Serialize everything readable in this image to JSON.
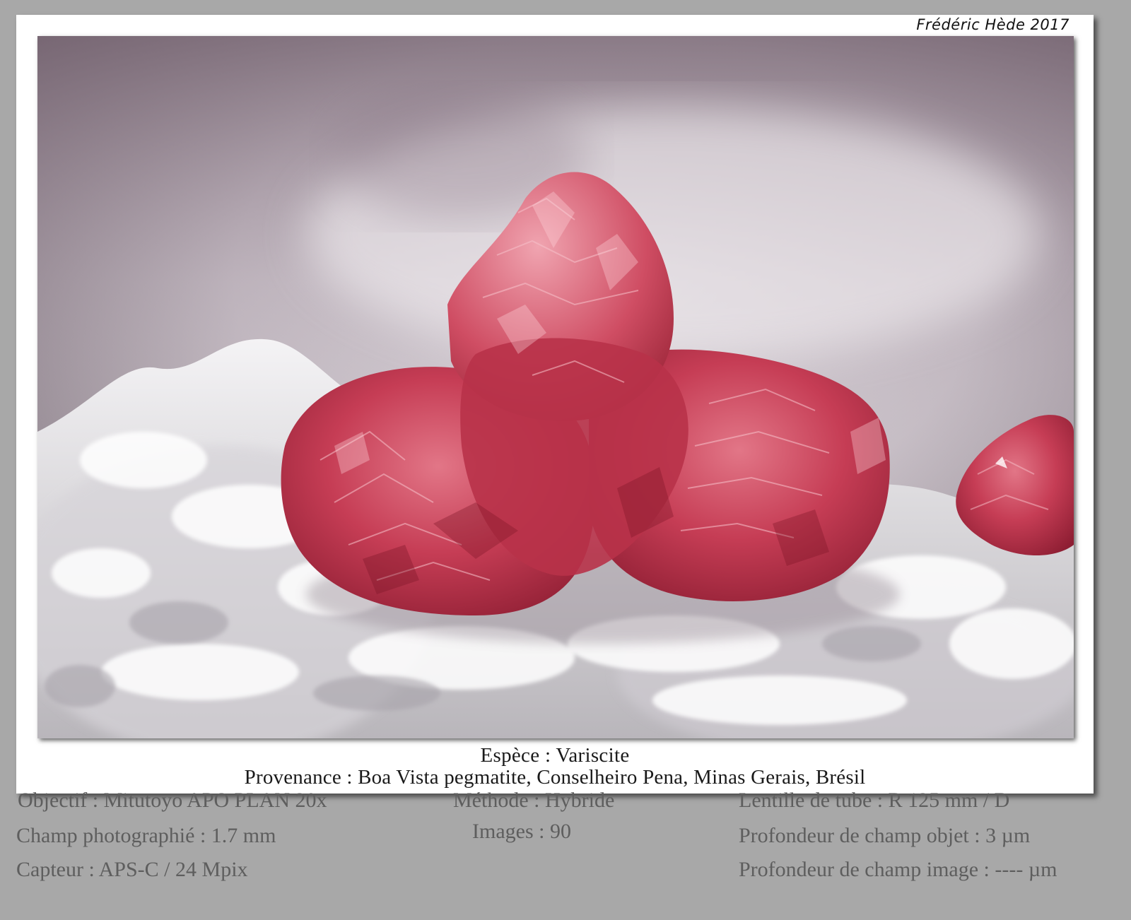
{
  "credit": "Frédéric Hède 2017",
  "caption": {
    "species": "Espèce : Variscite",
    "provenance": "Provenance : Boa Vista pegmatite, Conselheiro Pena, Minas Gerais, Brésil"
  },
  "specs": {
    "objective": "Objectif : Mitutoyo APO PLAN 20x",
    "field": "Champ photographié : 1.7 mm",
    "sensor": "Capteur : APS-C / 24 Mpix",
    "method": "Méthode : Hybride",
    "images": "Images : 90",
    "tube_lens": "Lentille de tube : R 125 mm / D",
    "dof_object": "Profondeur de champ objet : 3 µm",
    "dof_image": "Profondeur de champ image : ---- µm"
  },
  "photo": {
    "subject": "variscite-crystal-cluster",
    "crystal_color": "#c23a4e",
    "matrix_color": "#e4e2e6",
    "background_color": "#b7acb6"
  }
}
